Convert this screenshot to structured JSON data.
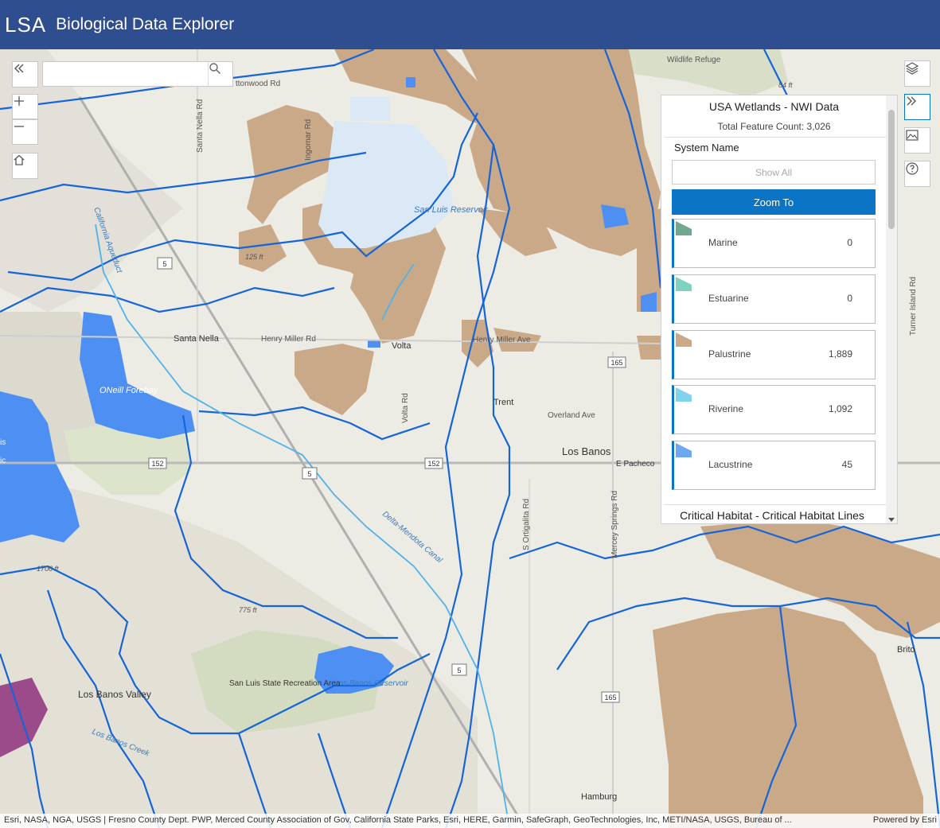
{
  "header": {
    "logo": "LSA",
    "title": "Biological Data Explorer"
  },
  "search": {
    "placeholder": ""
  },
  "map_labels": {
    "place": [
      "Santa Nella",
      "Volta",
      "Trent",
      "Los Banos",
      "Brito",
      "Hamburg"
    ],
    "water": [
      "San Luis Reservoir",
      "ONeill Forebay",
      "Los Banos Reservoir",
      "Delta-Mendota Canal",
      "California Aqueduct",
      "Los Banos Creek"
    ],
    "park": [
      "San Luis State Recreation Area",
      "Los Banos Valley",
      "Wildlife Refuge"
    ],
    "roads": [
      "Santa Nella Rd",
      "Henry Miller Rd",
      "Henry Miller Ave",
      "Volta Rd",
      "Overland Ave",
      "E Pacheco",
      "S Ortigalita Rd",
      "Mercey Springs Rd",
      "Turner Island Rd",
      "Ingomar Rd",
      "ttonwood Rd"
    ],
    "elevation": [
      "125 ft",
      "1700 ft",
      "775 ft",
      "84 ft"
    ],
    "shields": [
      "5",
      "152",
      "165"
    ],
    "fragments": [
      "is",
      "ic"
    ]
  },
  "panel": {
    "layer_title": "USA Wetlands - NWI Data",
    "feature_count": "Total Feature Count: 3,026",
    "field_name": "System Name",
    "show_all_label": "Show All",
    "zoom_to_label": "Zoom To",
    "categories": [
      {
        "label": "Marine",
        "count": "0",
        "color": "#6fa88e"
      },
      {
        "label": "Estuarine",
        "count": "0",
        "color": "#7dd3c0"
      },
      {
        "label": "Palustrine",
        "count": "1,889",
        "color": "#c9a988"
      },
      {
        "label": "Riverine",
        "count": "1,092",
        "color": "#7fd3ef"
      },
      {
        "label": "Lacustrine",
        "count": "45",
        "color": "#6ea8f2"
      }
    ],
    "next_layer_title": "Critical Habitat - Critical Habitat Lines"
  },
  "attribution": {
    "text": "Esri, NASA, NGA, USGS | Fresno County Dept. PWP, Merced County Association of Gov, California State Parks, Esri, HERE, Garmin, SafeGraph, GeoTechnologies, Inc, METI/NASA, USGS, Bureau of ...",
    "powered": "Powered by Esri"
  },
  "icons": [
    "collapse-left-icon",
    "search-icon",
    "zoom-in-icon",
    "zoom-out-icon",
    "home-icon",
    "layers-icon",
    "expand-right-icon",
    "basemap-icon",
    "help-icon"
  ],
  "colors": {
    "header": "#2f4e8f",
    "accent": "#0b74c4",
    "watershed": "#1565d8",
    "wetland": "#c9a988",
    "water": "#4d8ff2"
  }
}
